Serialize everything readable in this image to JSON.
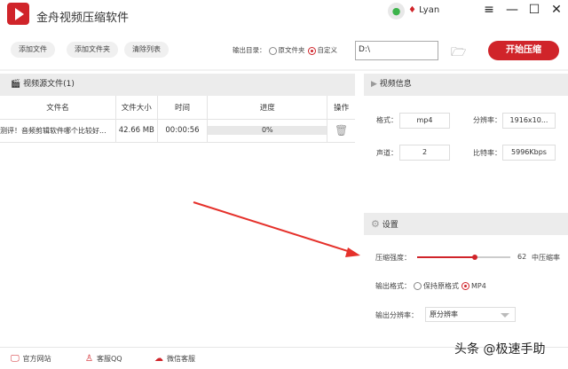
{
  "app": {
    "title": "金舟视频压缩软件",
    "user": "Lyan"
  },
  "toolbar": {
    "add_file": "添加文件",
    "add_folder": "添加文件夹",
    "clear_list": "清除列表",
    "output_dir_label": "输出目录：",
    "opt_source": "原文件夹",
    "opt_custom": "自定义",
    "path": "D:\\",
    "start": "开始压缩"
  },
  "source": {
    "title": "视频源文件(1)",
    "columns": [
      "文件名",
      "文件大小",
      "时间",
      "进度",
      "操作"
    ],
    "rows": [
      {
        "name": "测评！音频剪辑软件哪个比较好...",
        "size": "42.66 MB",
        "time": "00:00:56",
        "progress": "0%"
      }
    ]
  },
  "info": {
    "title": "视频信息",
    "format_label": "格式：",
    "format": "mp4",
    "resolution_label": "分辨率：",
    "resolution": "1916x10...",
    "channel_label": "声道：",
    "channel": "2",
    "bitrate_label": "比特率：",
    "bitrate": "5996Kbps"
  },
  "settings": {
    "title": "设置",
    "strength_label": "压缩强度：",
    "strength_value": "62",
    "strength_text": "中压缩率",
    "format_label": "输出格式：",
    "opt_keep": "保持原格式",
    "opt_mp4": "MP4",
    "resolution_label": "输出分辨率：",
    "resolution_value": "原分辨率"
  },
  "footer": {
    "website": "官方网站",
    "qq": "客服QQ",
    "wechat": "微信客服"
  },
  "watermark": "头条 @极速手助",
  "colors": {
    "accent": "#d0242a"
  }
}
